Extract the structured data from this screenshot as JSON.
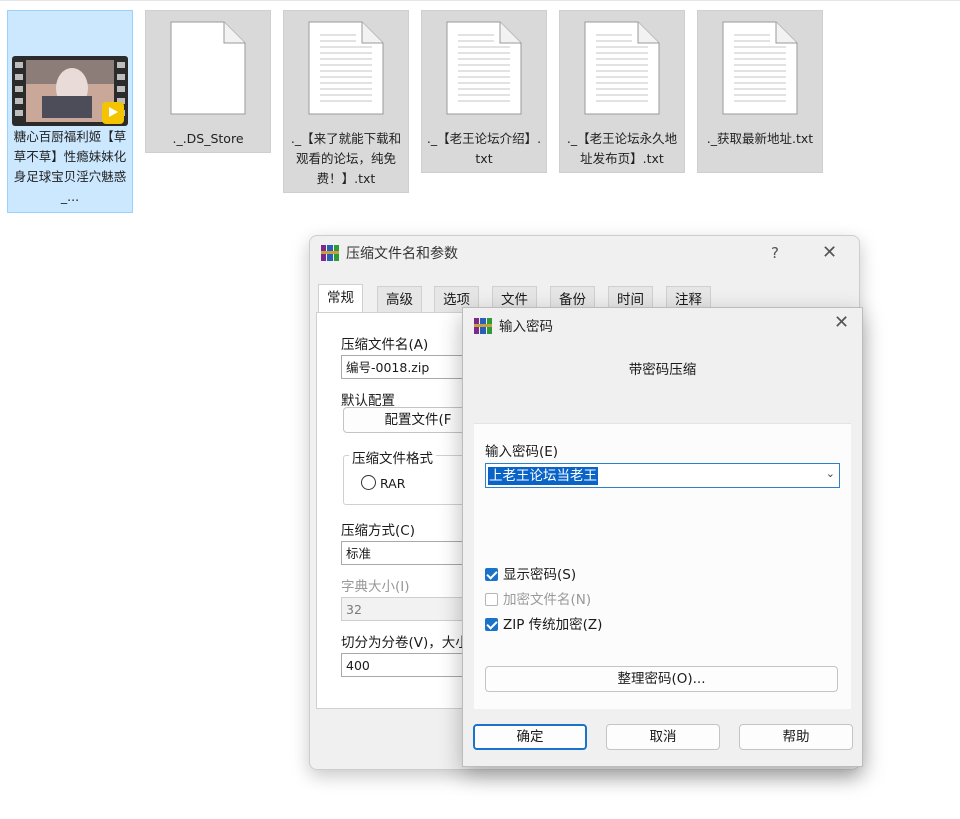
{
  "files": [
    {
      "name": "糖心百厨福利姬【草草不草】性瘾妹妹化身足球宝贝淫穴魅惑_...",
      "type": "video",
      "selected": true
    },
    {
      "name": "._.DS_Store",
      "type": "file"
    },
    {
      "name": "._【来了就能下载和观看的论坛，纯免费！】.txt",
      "type": "text"
    },
    {
      "name": "._【老王论坛介绍】.txt",
      "type": "text"
    },
    {
      "name": "._【老王论坛永久地址发布页】.txt",
      "type": "text"
    },
    {
      "name": "._获取最新地址.txt",
      "type": "text"
    }
  ],
  "archive_dialog": {
    "title": "压缩文件名和参数",
    "help_glyph": "?",
    "close_glyph": "✕",
    "tabs": [
      "常规",
      "高级",
      "选项",
      "文件",
      "备份",
      "时间",
      "注释"
    ],
    "archive_name_label": "压缩文件名(A)",
    "archive_name_value": "编号-0018.zip",
    "default_profile_label": "默认配置",
    "profiles_button": "配置文件(F",
    "format_group_label": "压缩文件格式",
    "format_rar": "RAR",
    "method_label": "压缩方式(C)",
    "method_value": "标准",
    "dict_label": "字典大小(I)",
    "dict_value": "32",
    "split_label": "切分为分卷(V)，大小",
    "split_value": "400"
  },
  "password_dialog": {
    "title": "输入密码",
    "close_glyph": "✕",
    "heading": "带密码压缩",
    "password_label": "输入密码(E)",
    "password_value": "上老王论坛当老王",
    "show_password": {
      "label": "显示密码(S)",
      "checked": true
    },
    "encrypt_names": {
      "label": "加密文件名(N)",
      "checked": false
    },
    "zip_legacy": {
      "label": "ZIP 传统加密(Z)",
      "checked": true
    },
    "organize_button": "整理密码(O)...",
    "ok_button": "确定",
    "cancel_button": "取消",
    "help_button": "帮助"
  },
  "colors": {
    "selection": "#cce8ff",
    "accent": "#1a73c8"
  }
}
